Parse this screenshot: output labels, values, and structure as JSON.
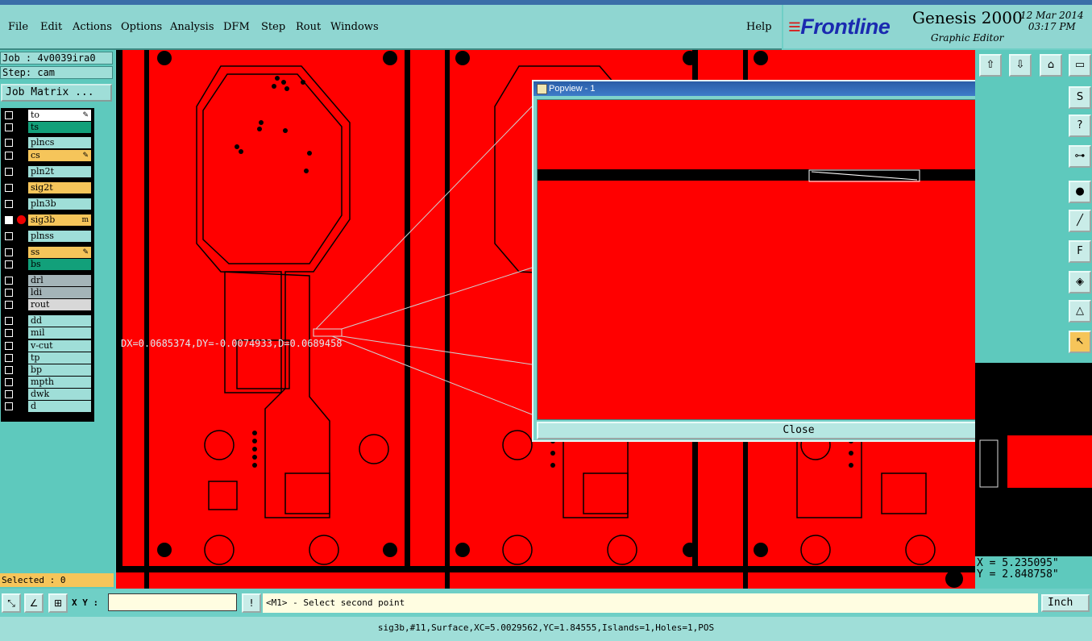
{
  "menubar": {
    "items": [
      "File",
      "Edit",
      "Actions",
      "Options",
      "Analysis",
      "DFM",
      "Step",
      "Rout",
      "Windows"
    ],
    "help": "Help"
  },
  "brand": {
    "logo": "Frontline",
    "product": "Genesis 2000",
    "subtitle": "Graphic Editor",
    "date": "12 Mar 2014",
    "time": "03:17 PM"
  },
  "job": {
    "job_line": "Job : 4v0039ira0",
    "step_line": "Step: cam",
    "matrix_button": "Job Matrix ..."
  },
  "layers": [
    {
      "name": "to",
      "color": "#ffffff",
      "checked": false,
      "mark": "✎"
    },
    {
      "name": "ts",
      "color": "#12a07a",
      "checked": false,
      "mark": ""
    },
    {
      "name": "plncs",
      "color": "#9fded8",
      "checked": false,
      "mark": ""
    },
    {
      "name": "cs",
      "color": "#f6c55a",
      "checked": false,
      "mark": "✎"
    },
    {
      "name": "pln2t",
      "color": "#9fded8",
      "checked": false,
      "mark": ""
    },
    {
      "name": "sig2t",
      "color": "#f6c55a",
      "checked": false,
      "mark": ""
    },
    {
      "name": "pln3b",
      "color": "#9fded8",
      "checked": false,
      "mark": ""
    },
    {
      "name": "sig3b",
      "color": "#f6c55a",
      "checked": true,
      "mark": "m"
    },
    {
      "name": "plnss",
      "color": "#9fded8",
      "checked": false,
      "mark": ""
    },
    {
      "name": "ss",
      "color": "#f6c55a",
      "checked": false,
      "mark": "✎"
    },
    {
      "name": "bs",
      "color": "#12a07a",
      "checked": false,
      "mark": ""
    },
    {
      "name": "drl",
      "color": "#a4b4b8",
      "checked": false,
      "mark": ""
    },
    {
      "name": "ldi",
      "color": "#a4b4b8",
      "checked": false,
      "mark": ""
    },
    {
      "name": "rout",
      "color": "#d8d8d8",
      "checked": false,
      "mark": ""
    },
    {
      "name": "dd",
      "color": "#9fded8",
      "checked": false,
      "mark": ""
    },
    {
      "name": "mil",
      "color": "#9fded8",
      "checked": false,
      "mark": ""
    },
    {
      "name": "v-cut",
      "color": "#9fded8",
      "checked": false,
      "mark": ""
    },
    {
      "name": "tp",
      "color": "#9fded8",
      "checked": false,
      "mark": ""
    },
    {
      "name": "bp",
      "color": "#9fded8",
      "checked": false,
      "mark": ""
    },
    {
      "name": "mpth",
      "color": "#9fded8",
      "checked": false,
      "mark": ""
    },
    {
      "name": "dwk",
      "color": "#9fded8",
      "checked": false,
      "mark": ""
    },
    {
      "name": "d",
      "color": "#9fded8",
      "checked": false,
      "mark": ""
    }
  ],
  "selected": "Selected : 0",
  "measure": "DX=0.0685374,DY=-0.0074933,D=0.0689458",
  "popview": {
    "title": "Popview - 1",
    "close_x": "✕",
    "close_button": "Close"
  },
  "coords": {
    "x": "X = 5.235095\"",
    "y": "Y = 2.848758\""
  },
  "bottom": {
    "xy_label": "X Y :",
    "xy_value": "",
    "message": "<M1> - Select second point",
    "unit": "Inch"
  },
  "status": "sig3b,#11,Surface,XC=5.0029562,YC=1.84555,Islands=1,Holes=1,POS",
  "colors": {
    "copper": "#ff0000",
    "background": "#000000",
    "panel": "#5ec9bd",
    "highlight": "#f6c55a"
  }
}
